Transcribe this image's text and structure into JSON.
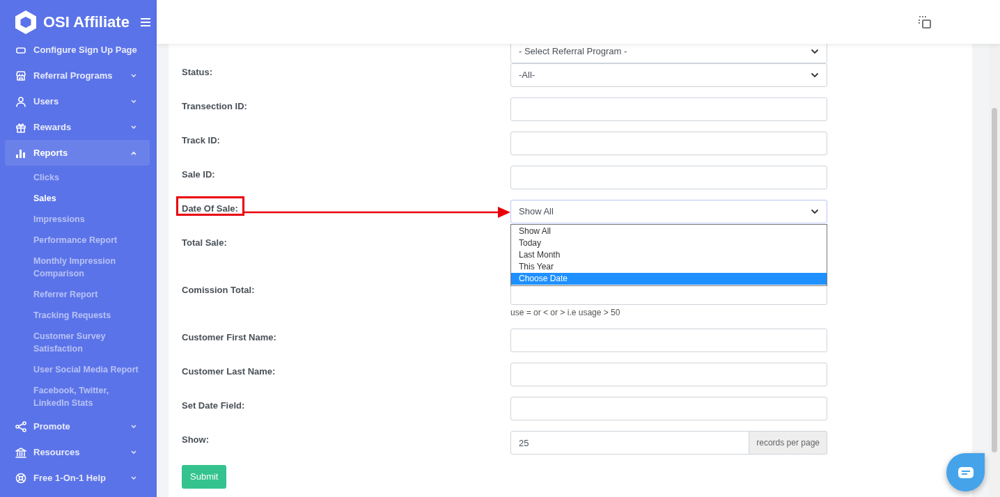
{
  "brand": "OSI Affiliate",
  "sidebar": {
    "items": [
      {
        "label": "Configure Sign Up Page",
        "selected": false
      },
      {
        "label": "Referral Programs",
        "selected": false,
        "expanded": false
      },
      {
        "label": "Users",
        "selected": false,
        "expanded": false
      },
      {
        "label": "Rewards",
        "selected": false,
        "expanded": false
      },
      {
        "label": "Reports",
        "selected": true,
        "expanded": true,
        "children": [
          {
            "label": "Clicks",
            "selected": false
          },
          {
            "label": "Sales",
            "selected": true
          },
          {
            "label": "Impressions",
            "selected": false
          },
          {
            "label": "Performance Report",
            "selected": false
          },
          {
            "label": "Monthly Impression Comparison",
            "selected": false
          },
          {
            "label": "Referrer Report",
            "selected": false
          },
          {
            "label": "Tracking Requests",
            "selected": false
          },
          {
            "label": "Customer Survey Satisfaction",
            "selected": false
          },
          {
            "label": "User Social Media Report",
            "selected": false
          },
          {
            "label": "Facebook, Twitter, LinkedIn Stats",
            "selected": false
          }
        ]
      },
      {
        "label": "Promote",
        "selected": false,
        "expanded": false
      },
      {
        "label": "Resources",
        "selected": false,
        "expanded": false
      },
      {
        "label": "Free 1-On-1 Help",
        "selected": false,
        "expanded": false
      }
    ]
  },
  "form": {
    "fields": [
      {
        "kind": "select",
        "value": "- Select Referral Program -"
      },
      {
        "label": "Status:",
        "kind": "select",
        "value": "-All-"
      },
      {
        "label": "Transection ID:",
        "kind": "text"
      },
      {
        "label": "Track ID:",
        "kind": "text"
      },
      {
        "label": "Sale ID:",
        "kind": "text"
      },
      {
        "label": "Date Of Sale:",
        "kind": "select",
        "value": "Show All",
        "focused": true,
        "annotated": true,
        "options": [
          {
            "label": "Show All",
            "highlighted": false
          },
          {
            "label": "Today",
            "highlighted": false
          },
          {
            "label": "Last Month",
            "highlighted": false
          },
          {
            "label": "This Year",
            "highlighted": false
          },
          {
            "label": "Choose Date",
            "highlighted": true
          }
        ]
      },
      {
        "label": "Total Sale:",
        "kind": "covered"
      },
      {
        "label": "Comission Total:",
        "kind": "text",
        "hint": "use = or < or > i.e usage > 50"
      },
      {
        "label": "Customer First Name:",
        "kind": "text"
      },
      {
        "label": "Customer Last Name:",
        "kind": "text"
      },
      {
        "label": "Set Date Field:",
        "kind": "text"
      },
      {
        "label": "Show:",
        "kind": "addon",
        "value": "25",
        "addon": "records per page"
      }
    ],
    "submit": "Submit"
  }
}
